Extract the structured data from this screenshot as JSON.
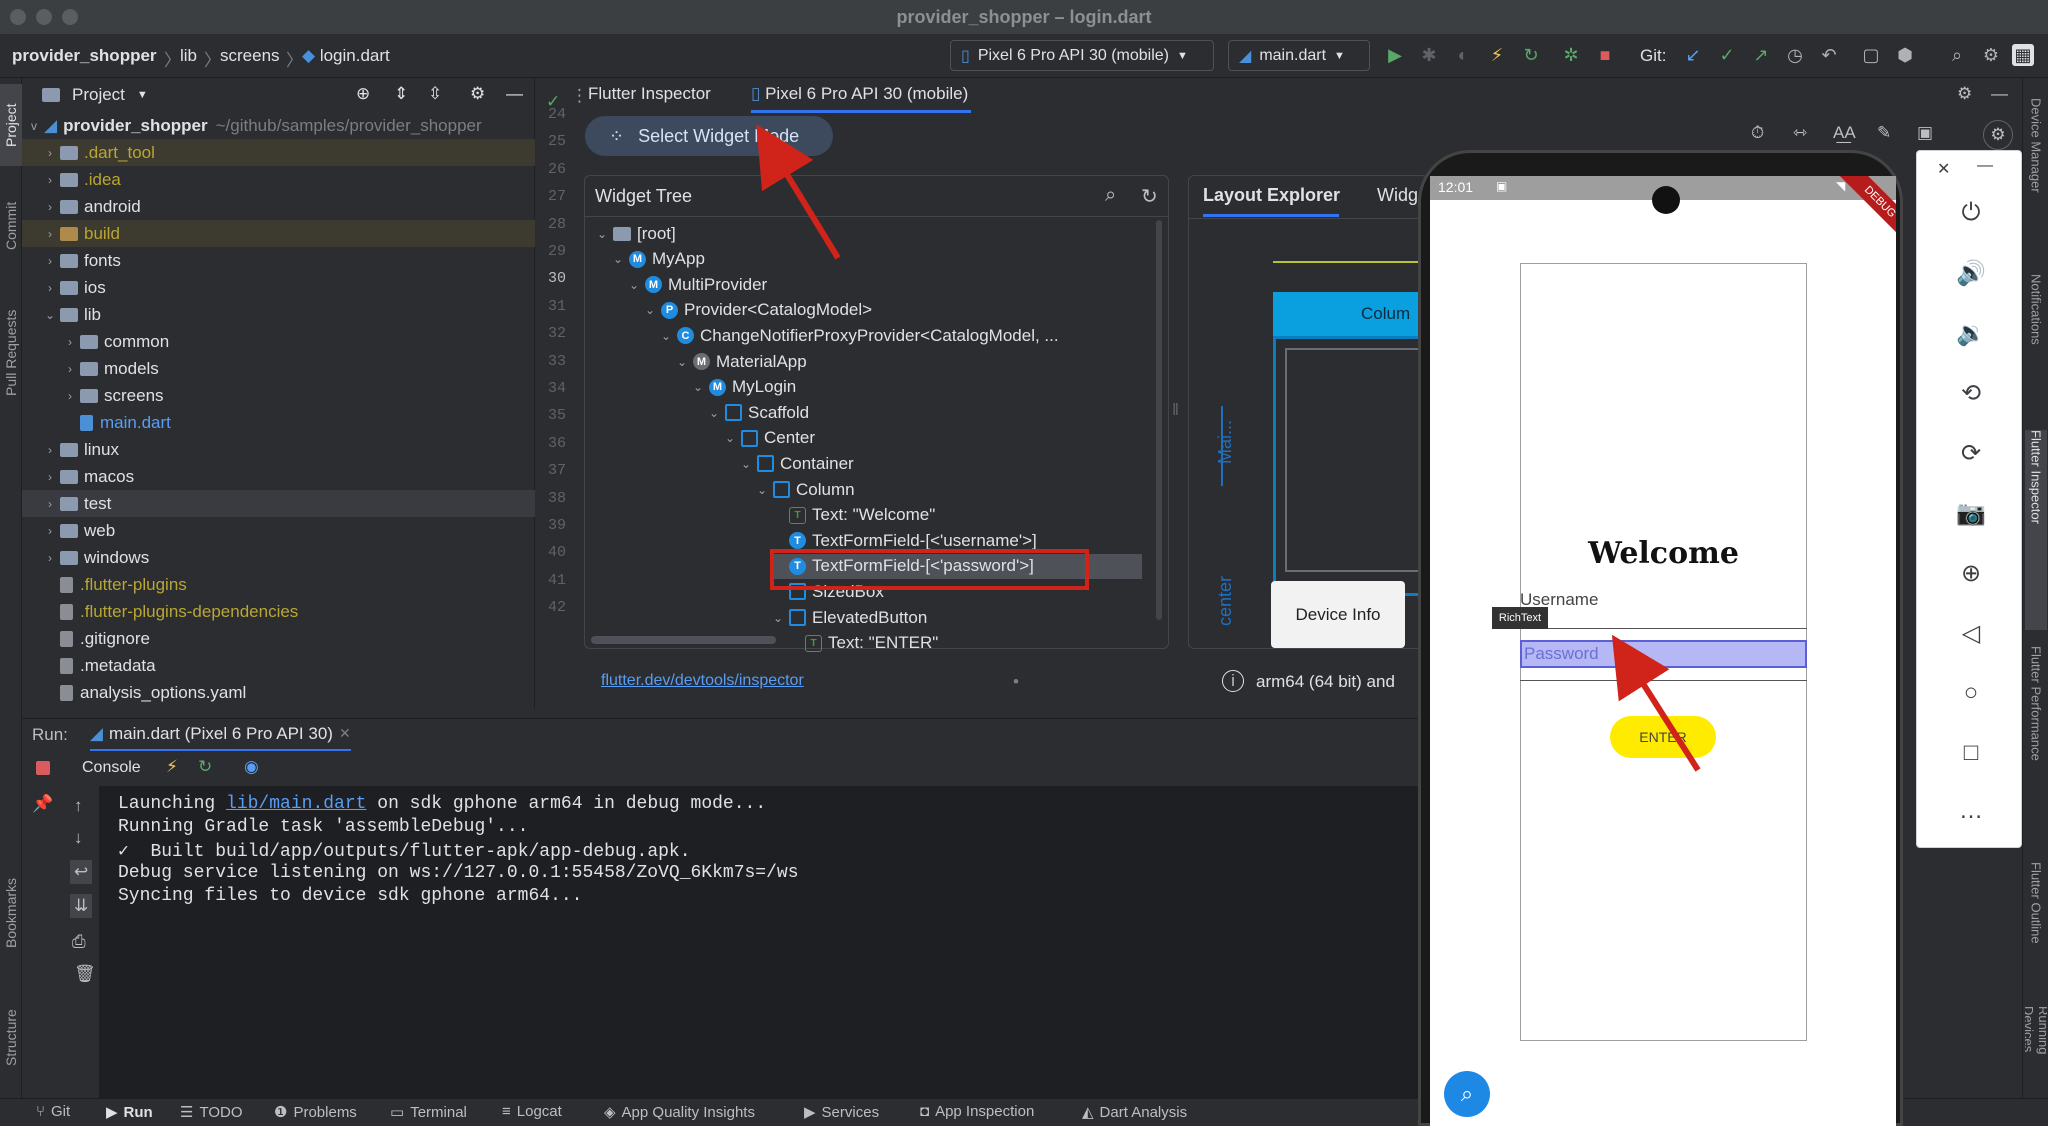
{
  "window": {
    "title": "provider_shopper – login.dart"
  },
  "breadcrumb": [
    "provider_shopper",
    "lib",
    "screens",
    "login.dart"
  ],
  "toolbar": {
    "device": "Pixel 6 Pro API 30 (mobile)",
    "run_config": "main.dart",
    "git_label": "Git:"
  },
  "left_strip": [
    "Project",
    "Commit",
    "Pull Requests",
    "Bookmarks",
    "Structure"
  ],
  "project": {
    "header": "Project",
    "root_name": "provider_shopper",
    "root_path": "~/github/samples/provider_shopper",
    "items": [
      {
        "name": ".dart_tool",
        "type": "folder",
        "style": "yellow",
        "depth": 1,
        "expand": ">"
      },
      {
        "name": ".idea",
        "type": "folder",
        "style": "yellow",
        "depth": 1,
        "expand": ">"
      },
      {
        "name": "android",
        "type": "folder",
        "style": "normal",
        "depth": 1,
        "expand": ">"
      },
      {
        "name": "build",
        "type": "folder",
        "style": "orange",
        "depth": 1,
        "expand": ">"
      },
      {
        "name": "fonts",
        "type": "folder",
        "style": "normal",
        "depth": 1,
        "expand": ">"
      },
      {
        "name": "ios",
        "type": "folder",
        "style": "normal",
        "depth": 1,
        "expand": ">"
      },
      {
        "name": "lib",
        "type": "folder",
        "style": "normal",
        "depth": 1,
        "expand": "v"
      },
      {
        "name": "common",
        "type": "folder",
        "style": "normal",
        "depth": 2,
        "expand": ">"
      },
      {
        "name": "models",
        "type": "folder",
        "style": "normal",
        "depth": 2,
        "expand": ">"
      },
      {
        "name": "screens",
        "type": "folder",
        "style": "normal",
        "depth": 2,
        "expand": ">"
      },
      {
        "name": "main.dart",
        "type": "dart",
        "style": "blue",
        "depth": 2,
        "expand": ""
      },
      {
        "name": "linux",
        "type": "folder",
        "style": "normal",
        "depth": 1,
        "expand": ">"
      },
      {
        "name": "macos",
        "type": "folder",
        "style": "normal",
        "depth": 1,
        "expand": ">"
      },
      {
        "name": "test",
        "type": "folder",
        "style": "normal",
        "depth": 1,
        "expand": ">"
      },
      {
        "name": "web",
        "type": "folder",
        "style": "normal",
        "depth": 1,
        "expand": ">"
      },
      {
        "name": "windows",
        "type": "folder",
        "style": "normal",
        "depth": 1,
        "expand": ">"
      },
      {
        "name": ".flutter-plugins",
        "type": "file",
        "style": "yellow",
        "depth": 1,
        "expand": ""
      },
      {
        "name": ".flutter-plugins-dependencies",
        "type": "file",
        "style": "yellow",
        "depth": 1,
        "expand": ""
      },
      {
        "name": ".gitignore",
        "type": "file",
        "style": "normal",
        "depth": 1,
        "expand": ""
      },
      {
        "name": ".metadata",
        "type": "file",
        "style": "normal",
        "depth": 1,
        "expand": ""
      },
      {
        "name": "analysis_options.yaml",
        "type": "file",
        "style": "normal",
        "depth": 1,
        "expand": ""
      }
    ]
  },
  "gutter_lines": [
    "24",
    "25",
    "26",
    "27",
    "28",
    "29",
    "30",
    "31",
    "32",
    "33",
    "34",
    "35",
    "36",
    "37",
    "38",
    "39",
    "40",
    "41",
    "42"
  ],
  "inspector": {
    "tab_inspector": "Flutter Inspector",
    "tab_device": "Pixel 6 Pro API 30 (mobile)",
    "select_widget_mode": "Select Widget Mode",
    "widget_tree_title": "Widget Tree",
    "layout_explorer_tab": "Layout Explorer",
    "widget_details_tab": "Widg",
    "column_label": "Colum",
    "main_axis_label": "Mai...",
    "center_label": "center",
    "device_info": "Device Info",
    "docs_link": "flutter.dev/devtools/inspector",
    "arch_info": "arm64 (64 bit) and",
    "tree": [
      {
        "label": "[root]",
        "icon": "folder",
        "expand": "v"
      },
      {
        "label": "MyApp",
        "icon": "M",
        "expand": "v"
      },
      {
        "label": "MultiProvider",
        "icon": "M",
        "expand": "v"
      },
      {
        "label": "Provider<CatalogModel>",
        "icon": "P",
        "expand": "v"
      },
      {
        "label": "ChangeNotifierProxyProvider<CatalogModel, ...",
        "icon": "C",
        "expand": "v"
      },
      {
        "label": "MaterialApp",
        "icon": "mat",
        "expand": "v"
      },
      {
        "label": "MyLogin",
        "icon": "M",
        "expand": "v"
      },
      {
        "label": "Scaffold",
        "icon": "scaffold",
        "expand": "v"
      },
      {
        "label": "Center",
        "icon": "center",
        "expand": "v"
      },
      {
        "label": "Container",
        "icon": "container",
        "expand": "v"
      },
      {
        "label": "Column",
        "icon": "column",
        "expand": "v"
      },
      {
        "label": "Text: \"Welcome\"",
        "icon": "text",
        "expand": ""
      },
      {
        "label": "TextFormField-[<'username'>]",
        "icon": "T",
        "expand": ""
      },
      {
        "label": "TextFormField-[<'password'>]",
        "icon": "T",
        "expand": ""
      },
      {
        "label": "SizedBox",
        "icon": "sized",
        "expand": ""
      },
      {
        "label": "ElevatedButton",
        "icon": "button",
        "expand": "v"
      },
      {
        "label": "Text: \"ENTER\"",
        "icon": "text",
        "expand": ""
      }
    ]
  },
  "run": {
    "label": "Run:",
    "config_tab": "main.dart (Pixel 6 Pro API 30)",
    "console_tab": "Console",
    "console_lines": [
      {
        "prefix": "Launching ",
        "link": "lib/main.dart",
        "rest": " on sdk gphone arm64 in debug mode..."
      },
      {
        "prefix": "Running Gradle task 'assembleDebug'...",
        "link": "",
        "rest": ""
      },
      {
        "prefix": "✓  Built build/app/outputs/flutter-apk/app-debug.apk.",
        "link": "",
        "rest": ""
      },
      {
        "prefix": "Debug service listening on ws://127.0.0.1:55458/ZoVQ_6Kkm7s=/ws",
        "link": "",
        "rest": ""
      },
      {
        "prefix": "Syncing files to device sdk gphone arm64...",
        "link": "",
        "rest": ""
      }
    ]
  },
  "statusbar": [
    "Git",
    "Run",
    "TODO",
    "Problems",
    "Terminal",
    "Logcat",
    "App Quality Insights",
    "Services",
    "App Inspection",
    "Dart Analysis"
  ],
  "right_strip": [
    "Device Manager",
    "Notifications",
    "Flutter Inspector",
    "Flutter Performance",
    "Flutter Outline",
    "Running Devices"
  ],
  "phone": {
    "time": "12:01",
    "debug_banner": "DEBUG",
    "welcome": "Welcome",
    "username_label": "Username",
    "richtext_tooltip": "RichText",
    "password_placeholder": "Password",
    "enter_button": "ENTER"
  },
  "colors": {
    "accent": "#1f8ce0",
    "highlight_box": "#d0231a",
    "enter_button": "#ffeb00"
  }
}
